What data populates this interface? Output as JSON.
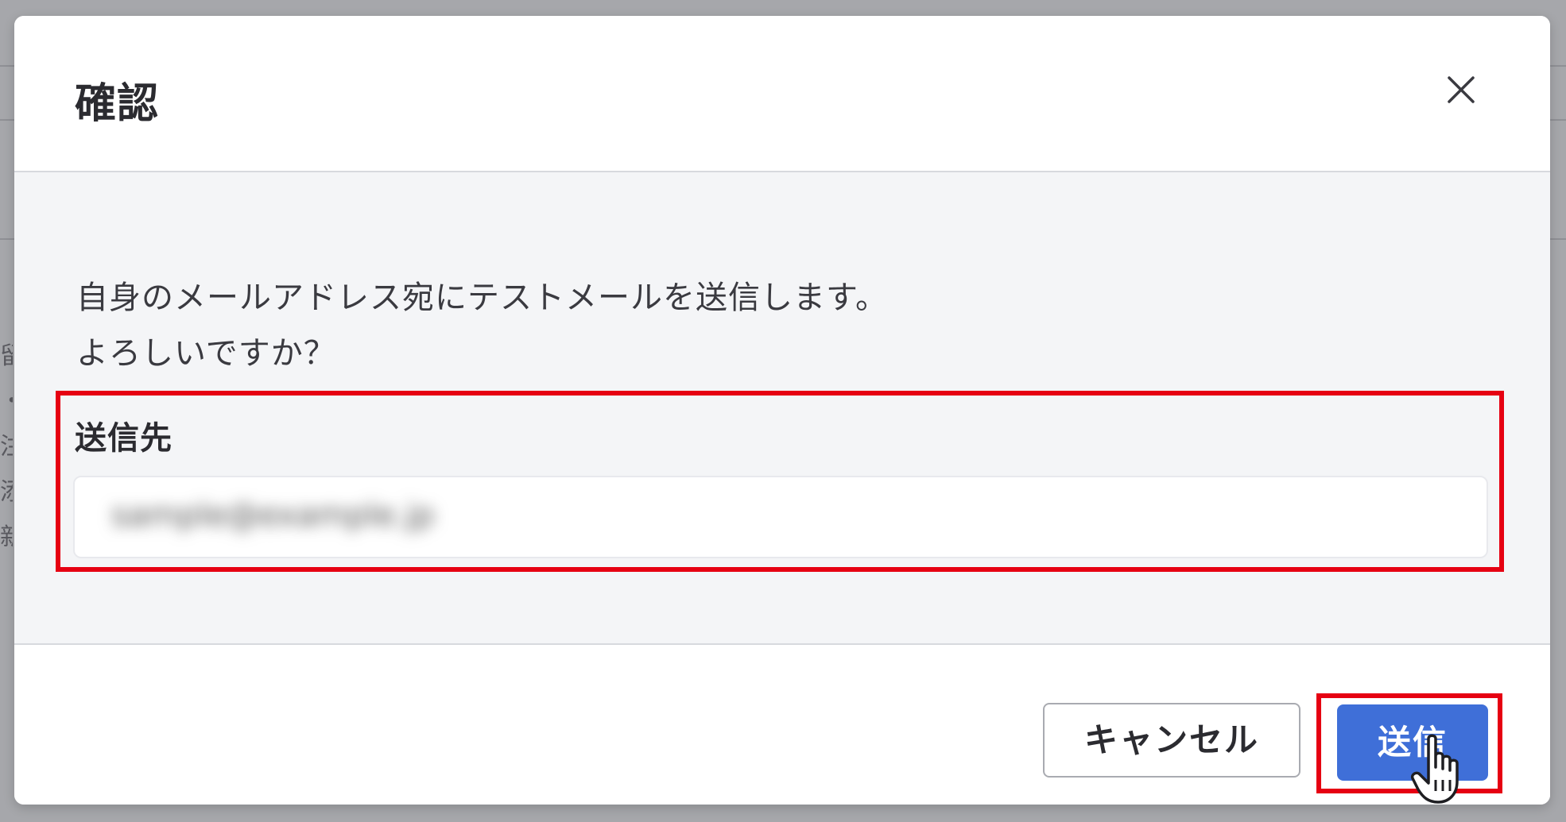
{
  "dialog": {
    "title": "確認",
    "close_icon": "close-icon",
    "message_lines": [
      "自身のメールアドレス宛にテストメールを送信します。",
      "よろしいですか？"
    ],
    "recipient": {
      "label": "送信先",
      "value": "sample@example.jp"
    },
    "buttons": {
      "cancel": "キャンセル",
      "send": "送信"
    }
  },
  "background_text": [
    "留",
    "・",
    "注",
    "添",
    "新"
  ],
  "colors": {
    "accent": "#3f6fd8",
    "highlight": "#e60012",
    "overlay": "#a6a7ab",
    "body_bg": "#f4f5f7"
  },
  "cursor_icon": "hand-pointer-icon"
}
